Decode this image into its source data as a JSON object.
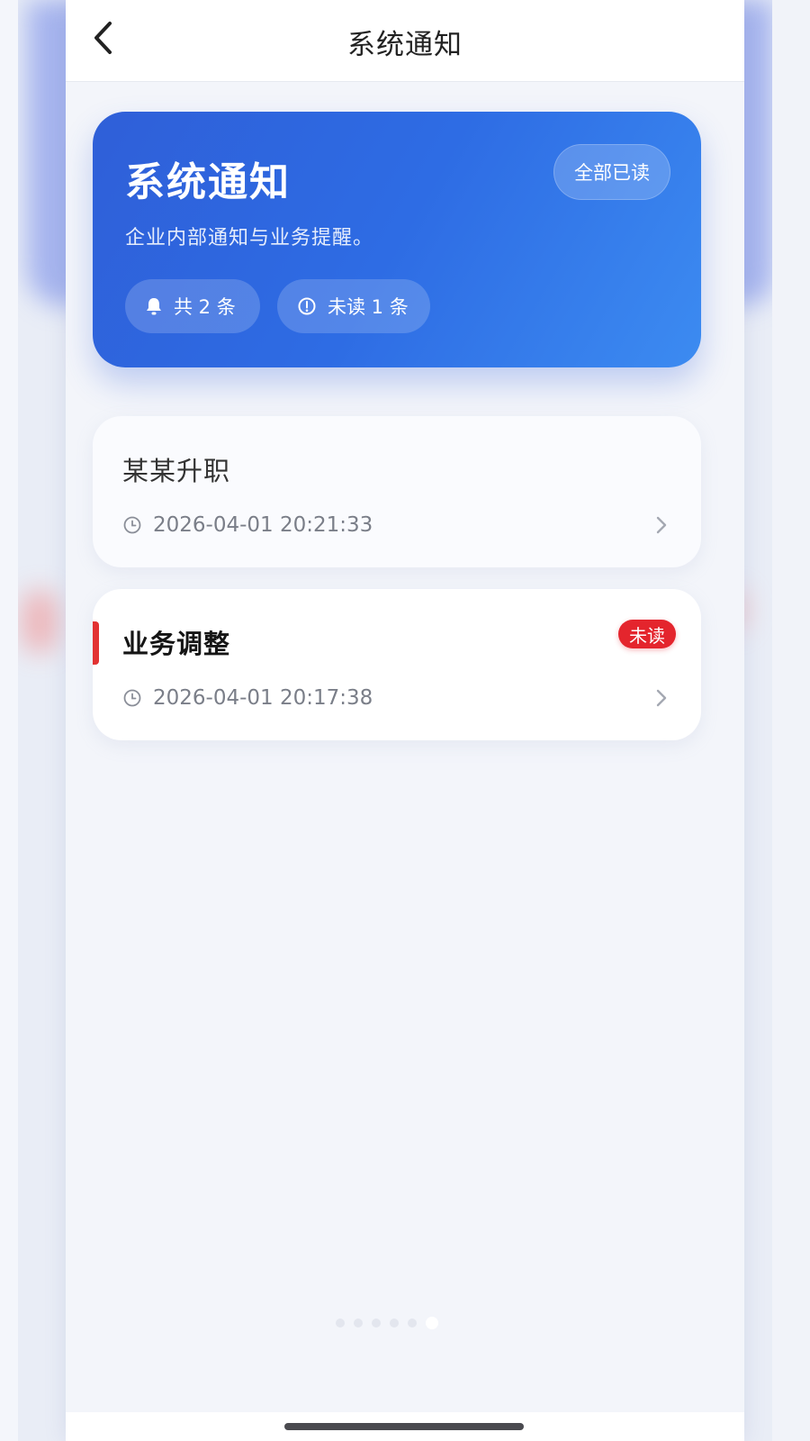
{
  "navbar": {
    "title": "系统通知",
    "back_icon": "chevron-left-icon"
  },
  "hero": {
    "title": "系统通知",
    "subtitle": "企业内部通知与业务提醒。",
    "mark_all_read_label": "全部已读",
    "total_pill": {
      "icon": "bell-icon",
      "label": "共 2 条"
    },
    "unread_pill": {
      "icon": "alert-circle-icon",
      "label": "未读 1 条"
    },
    "gradient_colors": [
      "#2f5fd8",
      "#3c8bf1"
    ]
  },
  "notifications": [
    {
      "title": "某某升职",
      "time": "2026-04-01 20:21:33",
      "unread": false
    },
    {
      "title": "业务调整",
      "time": "2026-04-01 20:17:38",
      "unread": true,
      "badge": "未读"
    }
  ],
  "colors": {
    "accent_blue": "#2e6ce4",
    "unread_red": "#e4252d"
  }
}
